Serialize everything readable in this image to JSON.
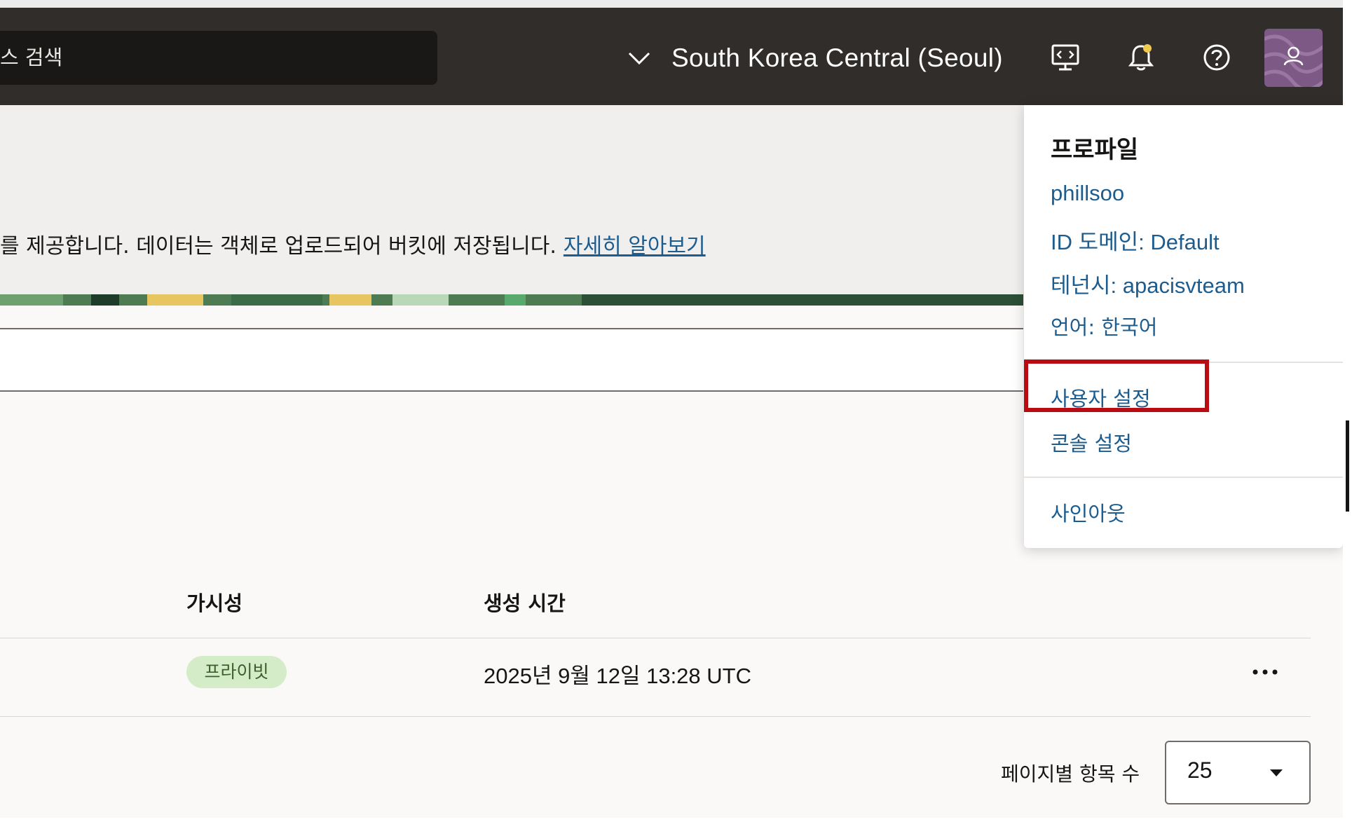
{
  "header": {
    "search_placeholder": "스 검색",
    "region_label": "South Korea Central (Seoul)"
  },
  "banner": {
    "description": "를 제공합니다. 데이터는 객체로 업로드되어 버킷에 저장됩니다.",
    "learn_more": "자세히 알아보기"
  },
  "table": {
    "columns": [
      "가시성",
      "생성 시간"
    ],
    "rows": [
      {
        "visibility": "프라이빗",
        "created": "2025년 9월 12일 13:28 UTC"
      }
    ],
    "page_size_label": "페이지별 항목 수",
    "page_size_value": "25"
  },
  "profile_menu": {
    "title": "프로파일",
    "username": "phillsoo",
    "identity_domain": "ID 도메인: Default",
    "tenancy": "테넌시: apacisvteam",
    "language": "언어: 한국어",
    "user_settings": "사용자 설정",
    "console_settings": "콘솔 설정",
    "sign_out": "사인아웃"
  },
  "colors": {
    "header_bg": "#312d2a",
    "link": "#1d5c8e",
    "highlight": "#b80c12",
    "badge_bg": "#d4ecc8"
  },
  "icons": [
    "chevron-down-icon",
    "developer-tools-icon",
    "bell-icon",
    "help-icon",
    "user-icon",
    "more-actions-icon",
    "caret-down-icon"
  ]
}
